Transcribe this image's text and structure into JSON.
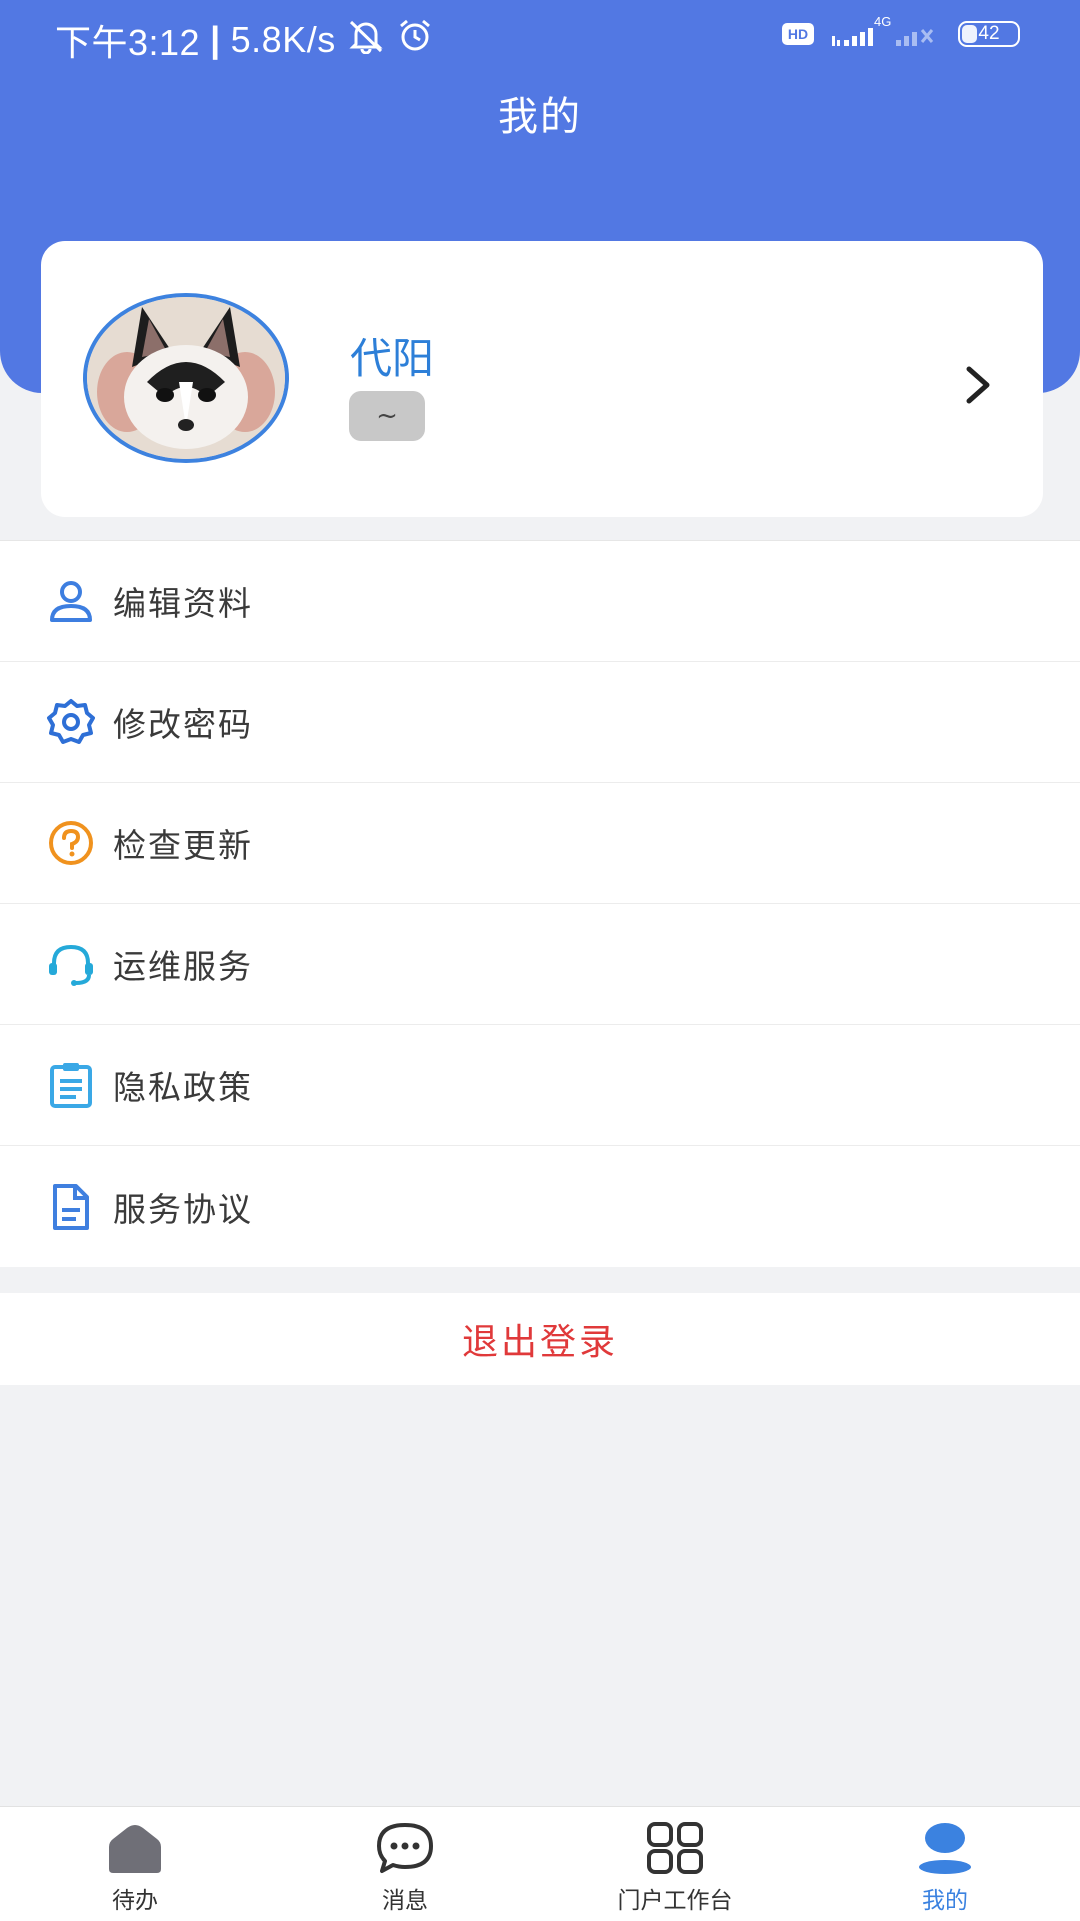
{
  "status_bar": {
    "time": "下午3:12",
    "separator": "|",
    "net_speed": "5.8K/s",
    "hd_label": "HD",
    "network_type": "4G",
    "battery_level": "42"
  },
  "header": {
    "title": "我的"
  },
  "profile": {
    "name": "代阳",
    "signature": "~"
  },
  "menu": {
    "items": [
      {
        "label": "编辑资料",
        "icon": "user-icon",
        "color": "#3d7ee0"
      },
      {
        "label": "修改密码",
        "icon": "gear-icon",
        "color": "#2e6fd6"
      },
      {
        "label": "检查更新",
        "icon": "question-circle-icon",
        "color": "#f0921e"
      },
      {
        "label": "运维服务",
        "icon": "headset-icon",
        "color": "#25a9d9"
      },
      {
        "label": "隐私政策",
        "icon": "clipboard-list-icon",
        "color": "#3aa8e6"
      },
      {
        "label": "服务协议",
        "icon": "document-icon",
        "color": "#3f7fdf"
      }
    ]
  },
  "logout_label": "退出登录",
  "tabbar": {
    "active_color": "#3b82e0",
    "items": [
      {
        "label": "待办",
        "icon": "home-icon"
      },
      {
        "label": "消息",
        "icon": "chat-icon"
      },
      {
        "label": "门户工作台",
        "icon": "grid-icon"
      },
      {
        "label": "我的",
        "icon": "profile-icon",
        "active": true
      }
    ]
  },
  "colors": {
    "header_blue": "#5278e3",
    "name_blue": "#2d7fd8",
    "logout_red": "#e0393a"
  }
}
